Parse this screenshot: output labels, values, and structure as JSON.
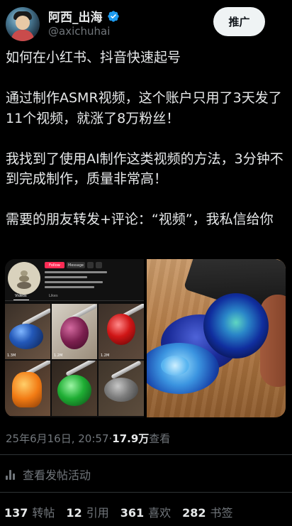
{
  "header": {
    "name": "阿西_出海",
    "handle": "@axichuhai",
    "promote_label": "推广",
    "verified": true,
    "accent": "#1d9bf0"
  },
  "tweet": {
    "paragraphs": [
      "如何在小红书、抖音快速起号",
      "通过制作ASMR视频，这个账户只用了3天发了11个视频，就涨了8万粉丝！",
      "我找到了使用AI制作这类视频的方法，3分钟不到完成制作，质量非常高！",
      "需要的朋友转发+评论：“视频”，我私信给你"
    ]
  },
  "media": {
    "tiktok_profile": {
      "follow_label": "Follow",
      "message_label": "Message",
      "tab_videos": "Videos",
      "tab_likes": "Likes",
      "cell_counts": [
        "1.3M",
        "1.2M",
        "1.2M",
        "",
        "",
        ""
      ]
    }
  },
  "meta": {
    "datetime": "25年6月16日, 20:57",
    "separator": " · ",
    "views": "17.9万",
    "views_label": " 查看"
  },
  "activity": {
    "label": "查看发帖活动"
  },
  "stats": {
    "retweets": {
      "num": "137",
      "label": "转帖"
    },
    "quotes": {
      "num": "12",
      "label": "引用"
    },
    "likes": {
      "num": "361",
      "label": "喜欢"
    },
    "bookmarks": {
      "num": "282",
      "label": "书签"
    }
  }
}
